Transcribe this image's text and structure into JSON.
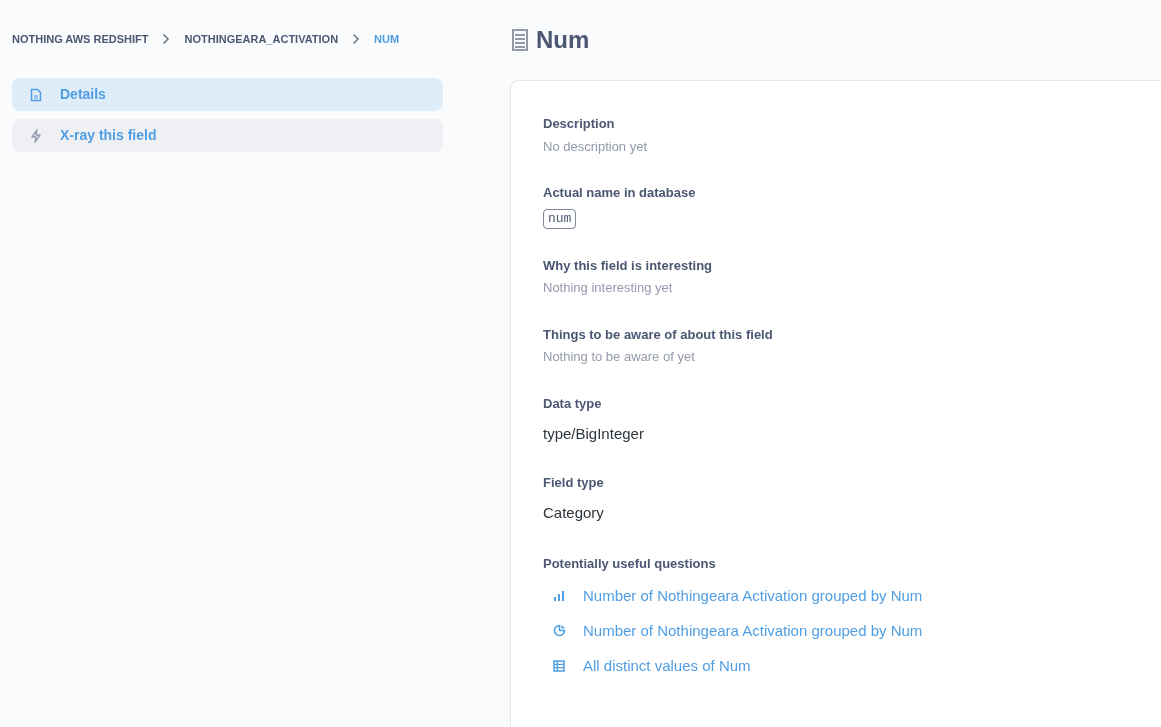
{
  "breadcrumbs": [
    {
      "label": "NOTHING AWS REDSHIFT",
      "selected": false
    },
    {
      "label": "NOTHINGEARA_ACTIVATION",
      "selected": false
    },
    {
      "label": "NUM",
      "selected": true
    }
  ],
  "sidebar": {
    "items": [
      {
        "label": "Details",
        "kind": "document",
        "selected": true
      },
      {
        "label": "X-ray this field",
        "kind": "bolt",
        "selected": false
      }
    ]
  },
  "title": "Num",
  "sections": [
    {
      "label": "Description",
      "kind": "empty",
      "value": "No description yet"
    },
    {
      "label": "Actual name in database",
      "kind": "code",
      "value": "num"
    },
    {
      "label": "Why this field is interesting",
      "kind": "empty",
      "value": "Nothing interesting yet"
    },
    {
      "label": "Things to be aware of about this field",
      "kind": "empty",
      "value": "Nothing to be aware of yet"
    },
    {
      "label": "Data type",
      "kind": "value",
      "value": "type/BigInteger"
    },
    {
      "label": "Field type",
      "kind": "value",
      "value": "Category"
    }
  ],
  "questions": {
    "heading": "Potentially useful questions",
    "items": [
      {
        "label": "Number of Nothingeara Activation grouped by Num",
        "kind": "bar"
      },
      {
        "label": "Number of Nothingeara Activation grouped by Num",
        "kind": "pie"
      },
      {
        "label": "All distinct values of Num",
        "kind": "table"
      }
    ]
  }
}
